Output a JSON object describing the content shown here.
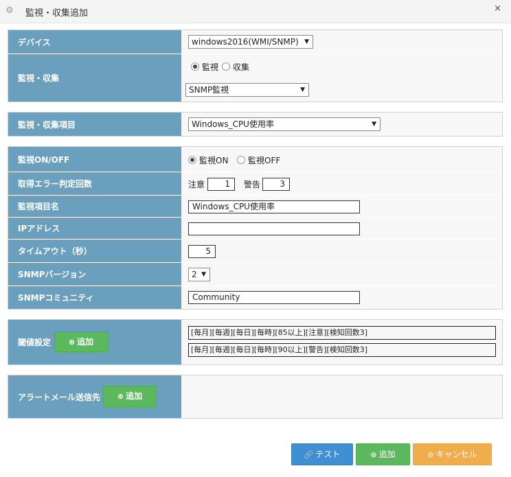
{
  "window": {
    "title": "監視・収集追加",
    "close": "×"
  },
  "device": {
    "label": "デバイス",
    "value": "windows2016(WMI/SNMP)"
  },
  "mode": {
    "label": "監視・収集",
    "opt_monitor": "監視",
    "opt_collect": "収集",
    "selected": "監視",
    "select_value": "SNMP監視"
  },
  "item": {
    "label": "監視・収集項目",
    "value": "Windows_CPU使用率"
  },
  "fields": {
    "onoff_label": "監視ON/OFF",
    "on": "監視ON",
    "off": "監視OFF",
    "onoff_selected": "監視ON",
    "error_label": "取得エラー判定回数",
    "caution_label": "注意",
    "caution_value": "1",
    "warning_label": "警告",
    "warning_value": "3",
    "name_label": "監視項目名",
    "name_value": "Windows_CPU使用率",
    "ip_label": "IPアドレス",
    "ip_value": "",
    "timeout_label": "タイムアウト（秒）",
    "timeout_value": "5",
    "snmpver_label": "SNMPバージョン",
    "snmpver_value": "2",
    "community_label": "SNMPコミュニティ",
    "community_value": "Community"
  },
  "threshold": {
    "label": "閾値設定",
    "add": "追加",
    "entries": [
      "[毎月][毎週][毎日][毎時][85以上][注意][検知回数3]",
      "[毎月][毎週][毎日][毎時][90以上][警告][検知回数3]"
    ]
  },
  "alert": {
    "label": "アラートメール送信先",
    "add": "追加"
  },
  "footer": {
    "test": "テスト",
    "add": "追加",
    "cancel": "キャンセル"
  },
  "colors": {
    "label_bg": "#6a9fbd",
    "green": "#5cb85c",
    "blue": "#3f8fd2",
    "orange": "#f0ad4e"
  },
  "icons": {
    "title": "gear-icon",
    "test": "link-icon",
    "add": "plus-circle-icon",
    "cancel": "ban-icon"
  }
}
